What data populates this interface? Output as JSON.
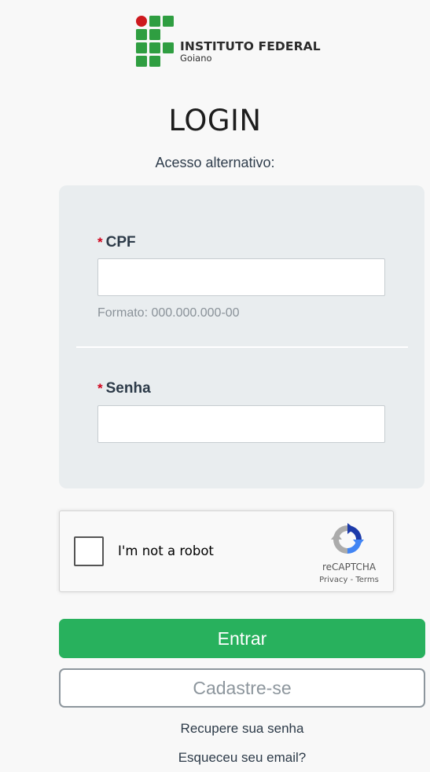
{
  "header": {
    "logo_title": "INSTITUTO FEDERAL",
    "logo_subtitle": "Goiano",
    "logo_colors": {
      "green": "#2f9e41",
      "red": "#cd191e"
    }
  },
  "page": {
    "title": "LOGIN",
    "alt_access": "Acesso alternativo:"
  },
  "form": {
    "required_mark": "*",
    "cpf": {
      "label": "CPF",
      "value": "",
      "placeholder": "",
      "hint": "Formato: 000.000.000-00"
    },
    "password": {
      "label": "Senha",
      "value": "",
      "placeholder": ""
    }
  },
  "recaptcha": {
    "checkbox_label": "I'm not a robot",
    "checked": false,
    "brand": "reCAPTCHA",
    "privacy": "Privacy",
    "separator": " - ",
    "terms": "Terms"
  },
  "actions": {
    "submit_label": "Entrar",
    "register_label": "Cadastre-se",
    "recover_password": "Recupere sua senha",
    "forgot_email": "Esqueceu seu email?"
  },
  "colors": {
    "primary": "#28b15d",
    "secondary_border": "#8d969d",
    "panel_bg": "#e9edef",
    "required": "#d0021b"
  }
}
